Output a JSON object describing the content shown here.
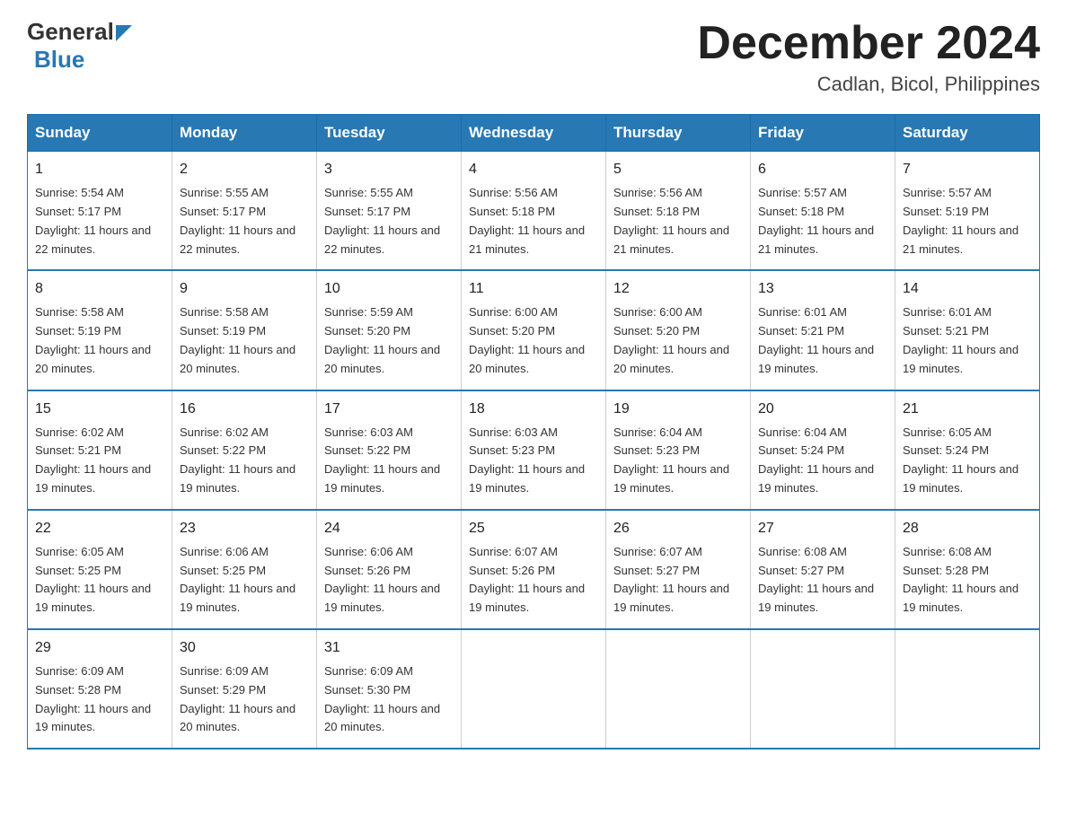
{
  "header": {
    "logo_general": "General",
    "logo_blue": "Blue",
    "month_title": "December 2024",
    "location": "Cadlan, Bicol, Philippines"
  },
  "days_of_week": [
    "Sunday",
    "Monday",
    "Tuesday",
    "Wednesday",
    "Thursday",
    "Friday",
    "Saturday"
  ],
  "weeks": [
    [
      {
        "day": "1",
        "sunrise": "Sunrise: 5:54 AM",
        "sunset": "Sunset: 5:17 PM",
        "daylight": "Daylight: 11 hours and 22 minutes."
      },
      {
        "day": "2",
        "sunrise": "Sunrise: 5:55 AM",
        "sunset": "Sunset: 5:17 PM",
        "daylight": "Daylight: 11 hours and 22 minutes."
      },
      {
        "day": "3",
        "sunrise": "Sunrise: 5:55 AM",
        "sunset": "Sunset: 5:17 PM",
        "daylight": "Daylight: 11 hours and 22 minutes."
      },
      {
        "day": "4",
        "sunrise": "Sunrise: 5:56 AM",
        "sunset": "Sunset: 5:18 PM",
        "daylight": "Daylight: 11 hours and 21 minutes."
      },
      {
        "day": "5",
        "sunrise": "Sunrise: 5:56 AM",
        "sunset": "Sunset: 5:18 PM",
        "daylight": "Daylight: 11 hours and 21 minutes."
      },
      {
        "day": "6",
        "sunrise": "Sunrise: 5:57 AM",
        "sunset": "Sunset: 5:18 PM",
        "daylight": "Daylight: 11 hours and 21 minutes."
      },
      {
        "day": "7",
        "sunrise": "Sunrise: 5:57 AM",
        "sunset": "Sunset: 5:19 PM",
        "daylight": "Daylight: 11 hours and 21 minutes."
      }
    ],
    [
      {
        "day": "8",
        "sunrise": "Sunrise: 5:58 AM",
        "sunset": "Sunset: 5:19 PM",
        "daylight": "Daylight: 11 hours and 20 minutes."
      },
      {
        "day": "9",
        "sunrise": "Sunrise: 5:58 AM",
        "sunset": "Sunset: 5:19 PM",
        "daylight": "Daylight: 11 hours and 20 minutes."
      },
      {
        "day": "10",
        "sunrise": "Sunrise: 5:59 AM",
        "sunset": "Sunset: 5:20 PM",
        "daylight": "Daylight: 11 hours and 20 minutes."
      },
      {
        "day": "11",
        "sunrise": "Sunrise: 6:00 AM",
        "sunset": "Sunset: 5:20 PM",
        "daylight": "Daylight: 11 hours and 20 minutes."
      },
      {
        "day": "12",
        "sunrise": "Sunrise: 6:00 AM",
        "sunset": "Sunset: 5:20 PM",
        "daylight": "Daylight: 11 hours and 20 minutes."
      },
      {
        "day": "13",
        "sunrise": "Sunrise: 6:01 AM",
        "sunset": "Sunset: 5:21 PM",
        "daylight": "Daylight: 11 hours and 19 minutes."
      },
      {
        "day": "14",
        "sunrise": "Sunrise: 6:01 AM",
        "sunset": "Sunset: 5:21 PM",
        "daylight": "Daylight: 11 hours and 19 minutes."
      }
    ],
    [
      {
        "day": "15",
        "sunrise": "Sunrise: 6:02 AM",
        "sunset": "Sunset: 5:21 PM",
        "daylight": "Daylight: 11 hours and 19 minutes."
      },
      {
        "day": "16",
        "sunrise": "Sunrise: 6:02 AM",
        "sunset": "Sunset: 5:22 PM",
        "daylight": "Daylight: 11 hours and 19 minutes."
      },
      {
        "day": "17",
        "sunrise": "Sunrise: 6:03 AM",
        "sunset": "Sunset: 5:22 PM",
        "daylight": "Daylight: 11 hours and 19 minutes."
      },
      {
        "day": "18",
        "sunrise": "Sunrise: 6:03 AM",
        "sunset": "Sunset: 5:23 PM",
        "daylight": "Daylight: 11 hours and 19 minutes."
      },
      {
        "day": "19",
        "sunrise": "Sunrise: 6:04 AM",
        "sunset": "Sunset: 5:23 PM",
        "daylight": "Daylight: 11 hours and 19 minutes."
      },
      {
        "day": "20",
        "sunrise": "Sunrise: 6:04 AM",
        "sunset": "Sunset: 5:24 PM",
        "daylight": "Daylight: 11 hours and 19 minutes."
      },
      {
        "day": "21",
        "sunrise": "Sunrise: 6:05 AM",
        "sunset": "Sunset: 5:24 PM",
        "daylight": "Daylight: 11 hours and 19 minutes."
      }
    ],
    [
      {
        "day": "22",
        "sunrise": "Sunrise: 6:05 AM",
        "sunset": "Sunset: 5:25 PM",
        "daylight": "Daylight: 11 hours and 19 minutes."
      },
      {
        "day": "23",
        "sunrise": "Sunrise: 6:06 AM",
        "sunset": "Sunset: 5:25 PM",
        "daylight": "Daylight: 11 hours and 19 minutes."
      },
      {
        "day": "24",
        "sunrise": "Sunrise: 6:06 AM",
        "sunset": "Sunset: 5:26 PM",
        "daylight": "Daylight: 11 hours and 19 minutes."
      },
      {
        "day": "25",
        "sunrise": "Sunrise: 6:07 AM",
        "sunset": "Sunset: 5:26 PM",
        "daylight": "Daylight: 11 hours and 19 minutes."
      },
      {
        "day": "26",
        "sunrise": "Sunrise: 6:07 AM",
        "sunset": "Sunset: 5:27 PM",
        "daylight": "Daylight: 11 hours and 19 minutes."
      },
      {
        "day": "27",
        "sunrise": "Sunrise: 6:08 AM",
        "sunset": "Sunset: 5:27 PM",
        "daylight": "Daylight: 11 hours and 19 minutes."
      },
      {
        "day": "28",
        "sunrise": "Sunrise: 6:08 AM",
        "sunset": "Sunset: 5:28 PM",
        "daylight": "Daylight: 11 hours and 19 minutes."
      }
    ],
    [
      {
        "day": "29",
        "sunrise": "Sunrise: 6:09 AM",
        "sunset": "Sunset: 5:28 PM",
        "daylight": "Daylight: 11 hours and 19 minutes."
      },
      {
        "day": "30",
        "sunrise": "Sunrise: 6:09 AM",
        "sunset": "Sunset: 5:29 PM",
        "daylight": "Daylight: 11 hours and 20 minutes."
      },
      {
        "day": "31",
        "sunrise": "Sunrise: 6:09 AM",
        "sunset": "Sunset: 5:30 PM",
        "daylight": "Daylight: 11 hours and 20 minutes."
      },
      {
        "day": "",
        "sunrise": "",
        "sunset": "",
        "daylight": ""
      },
      {
        "day": "",
        "sunrise": "",
        "sunset": "",
        "daylight": ""
      },
      {
        "day": "",
        "sunrise": "",
        "sunset": "",
        "daylight": ""
      },
      {
        "day": "",
        "sunrise": "",
        "sunset": "",
        "daylight": ""
      }
    ]
  ]
}
